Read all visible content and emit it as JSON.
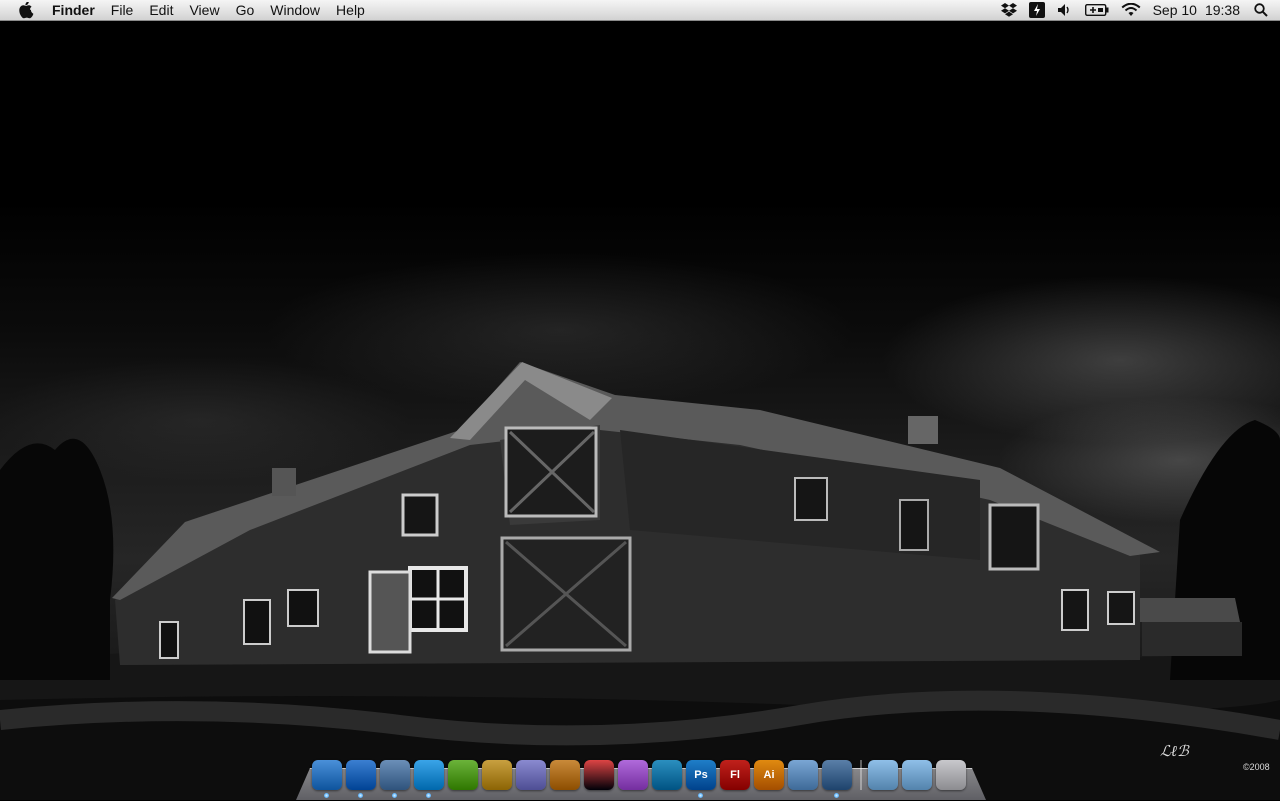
{
  "menubar": {
    "apple_icon": "apple-logo",
    "app_name": "Finder",
    "menus": [
      "File",
      "Edit",
      "View",
      "Go",
      "Window",
      "Help"
    ],
    "status_icons": [
      "dropbox-icon",
      "battery-app-icon",
      "volume-icon",
      "battery-icon",
      "wifi-icon"
    ],
    "date": "Sep 10",
    "time": "19:38",
    "spotlight_icon": "search-icon"
  },
  "desktop": {
    "signature_text": "©2008"
  },
  "dock": {
    "apps": [
      {
        "name": "Finder",
        "icon": "finder-icon",
        "color": "#4a90d9",
        "running": true
      },
      {
        "name": "Safari",
        "icon": "safari-icon",
        "color": "#3b7fd1",
        "running": true
      },
      {
        "name": "Mail",
        "icon": "mail-stamp-icon",
        "color": "#6b8fb8",
        "running": true
      },
      {
        "name": "iTunes",
        "icon": "itunes-icon",
        "color": "#3aa4e8",
        "running": true
      },
      {
        "name": "Spotify",
        "icon": "spotify-icon",
        "color": "#6bb33a",
        "running": false
      },
      {
        "name": "Reeder",
        "icon": "reeder-icon",
        "color": "#c8a040",
        "running": false
      },
      {
        "name": "Transmit",
        "icon": "transmit-truck-icon",
        "color": "#8a8ad0",
        "running": false
      },
      {
        "name": "Coda",
        "icon": "coffee-cup-icon",
        "color": "#c98a3a",
        "running": false
      },
      {
        "name": "CSSEdit",
        "icon": "cssedit-icon",
        "color": "#d44",
        "running": false
      },
      {
        "name": "iMac",
        "icon": "imac-icon",
        "color": "#b06adb",
        "running": false
      },
      {
        "name": "Versions",
        "icon": "box-icon",
        "color": "#2b8fbf",
        "running": false
      },
      {
        "name": "Photoshop",
        "label": "Ps",
        "icon": "photoshop-icon",
        "color": "#1f7ec8",
        "running": true
      },
      {
        "name": "Flash",
        "label": "Fl",
        "icon": "flash-icon",
        "color": "#c0211b",
        "running": false
      },
      {
        "name": "Illustrator",
        "label": "Ai",
        "icon": "illustrator-icon",
        "color": "#e08a10",
        "running": false
      },
      {
        "name": "More",
        "icon": "ellipsis-icon",
        "color": "#7aa6d4",
        "running": false
      },
      {
        "name": "Preview",
        "icon": "preview-icon",
        "color": "#5a7fa8",
        "running": true
      }
    ],
    "stacks": [
      {
        "name": "Downloads",
        "icon": "downloads-folder-icon",
        "color": "#8fbfe8"
      },
      {
        "name": "Applications",
        "icon": "applications-folder-icon",
        "color": "#8fbfe8"
      },
      {
        "name": "Trash",
        "icon": "trash-icon",
        "color": "#c8c8cc"
      }
    ]
  }
}
